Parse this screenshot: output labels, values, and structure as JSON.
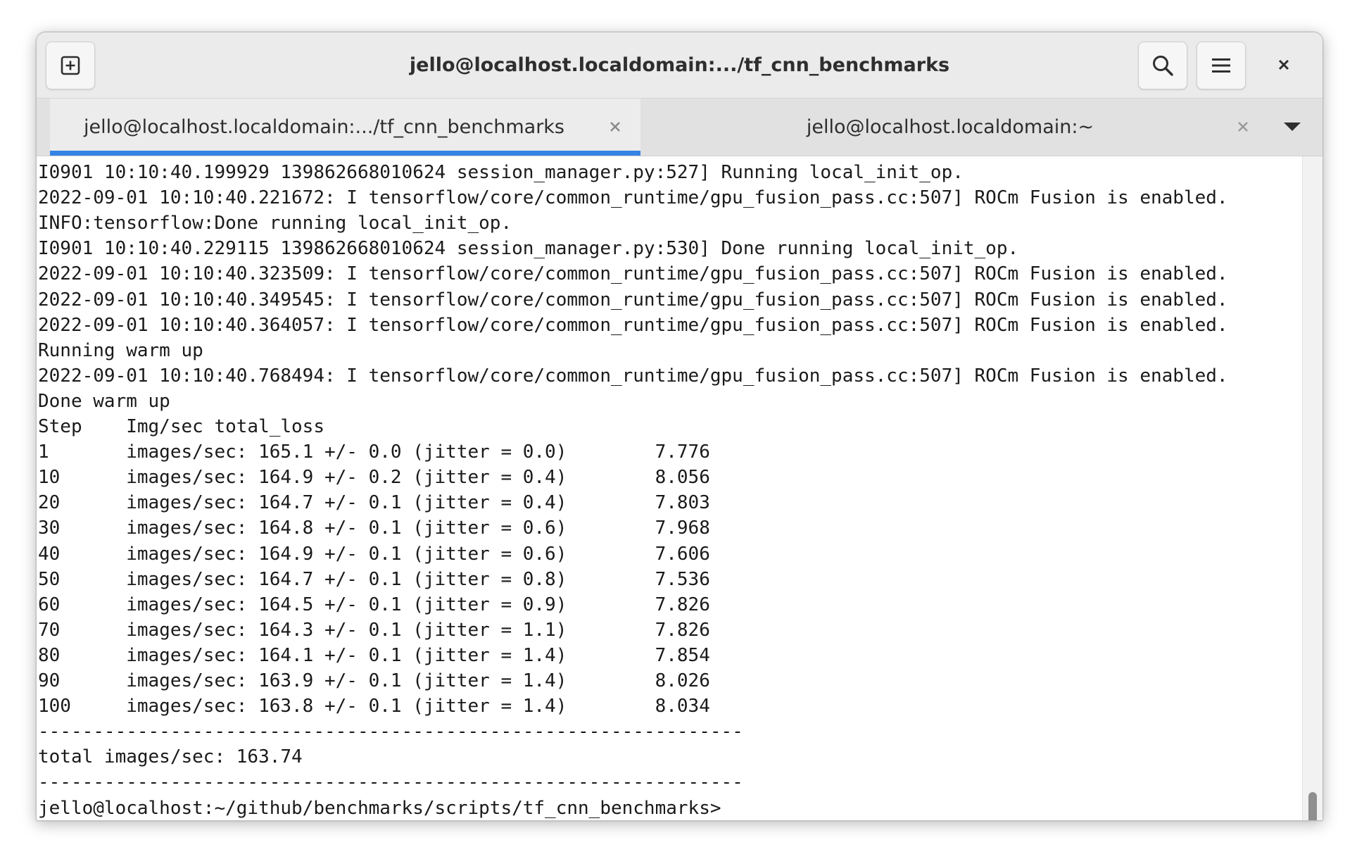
{
  "window": {
    "title": "jello@localhost.localdomain:.../tf_cnn_benchmarks"
  },
  "tabs": [
    {
      "label": "jello@localhost.localdomain:.../tf_cnn_benchmarks",
      "active": true
    },
    {
      "label": "jello@localhost.localdomain:~",
      "active": false
    }
  ],
  "icons": {
    "new_tab": "new-tab-icon",
    "search": "search-icon",
    "menu": "hamburger-menu-icon",
    "close": "close-icon",
    "tab_close": "tab-close-icon",
    "dropdown": "chevron-down-icon"
  },
  "colors": {
    "active_tab_indicator": "#3584e4",
    "titlebar": "#ebebeb",
    "tabbar": "#e1e1e1",
    "terminal_bg": "#ffffff",
    "terminal_fg": "#1a1a1a"
  },
  "terminal": {
    "lines": [
      "I0901 10:10:40.199929 139862668010624 session_manager.py:527] Running local_init_op.",
      "2022-09-01 10:10:40.221672: I tensorflow/core/common_runtime/gpu_fusion_pass.cc:507] ROCm Fusion is enabled.",
      "INFO:tensorflow:Done running local_init_op.",
      "I0901 10:10:40.229115 139862668010624 session_manager.py:530] Done running local_init_op.",
      "2022-09-01 10:10:40.323509: I tensorflow/core/common_runtime/gpu_fusion_pass.cc:507] ROCm Fusion is enabled.",
      "2022-09-01 10:10:40.349545: I tensorflow/core/common_runtime/gpu_fusion_pass.cc:507] ROCm Fusion is enabled.",
      "2022-09-01 10:10:40.364057: I tensorflow/core/common_runtime/gpu_fusion_pass.cc:507] ROCm Fusion is enabled.",
      "Running warm up",
      "2022-09-01 10:10:40.768494: I tensorflow/core/common_runtime/gpu_fusion_pass.cc:507] ROCm Fusion is enabled.",
      "Done warm up",
      "Step    Img/sec total_loss",
      "1       images/sec: 165.1 +/- 0.0 (jitter = 0.0)        7.776",
      "10      images/sec: 164.9 +/- 0.2 (jitter = 0.4)        8.056",
      "20      images/sec: 164.7 +/- 0.1 (jitter = 0.4)        7.803",
      "30      images/sec: 164.8 +/- 0.1 (jitter = 0.6)        7.968",
      "40      images/sec: 164.9 +/- 0.1 (jitter = 0.6)        7.606",
      "50      images/sec: 164.7 +/- 0.1 (jitter = 0.8)        7.536",
      "60      images/sec: 164.5 +/- 0.1 (jitter = 0.9)        7.826",
      "70      images/sec: 164.3 +/- 0.1 (jitter = 1.1)        7.826",
      "80      images/sec: 164.1 +/- 0.1 (jitter = 1.4)        7.854",
      "90      images/sec: 163.9 +/- 0.1 (jitter = 1.4)        8.026",
      "100     images/sec: 163.8 +/- 0.1 (jitter = 1.4)        8.034",
      "----------------------------------------------------------------",
      "total images/sec: 163.74",
      "----------------------------------------------------------------",
      "jello@localhost:~/github/benchmarks/scripts/tf_cnn_benchmarks>"
    ]
  }
}
